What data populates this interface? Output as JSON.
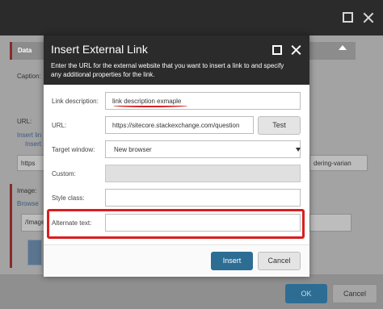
{
  "outer": {
    "section_label": "Data",
    "caption_label": "Caption:",
    "url_label": "URL:",
    "insert_link": "Insert lin",
    "insert_link2": "Insert",
    "url_field_value": "https",
    "url_field_right": "dering-varian",
    "image_label": "Image:",
    "browse_link": "Browse",
    "image_field_value": "/Image",
    "ok_label": "OK",
    "cancel_label": "Cancel"
  },
  "dialog": {
    "title": "Insert External Link",
    "description": "Enter the URL for the external website that you want to insert a link to and specify any additional properties for the link.",
    "link_description_label": "Link description:",
    "link_description_value": "link description exmaple",
    "url_label": "URL:",
    "url_value": "https://sitecore.stackexchange.com/question",
    "test_label": "Test",
    "target_window_label": "Target window:",
    "target_window_value": "New browser",
    "custom_label": "Custom:",
    "style_class_label": "Style class:",
    "alternate_text_label": "Alternate text:",
    "insert_label": "Insert",
    "cancel_label": "Cancel"
  },
  "colors": {
    "titlebar": "#2b2b2b",
    "primary_button": "#2d6d94",
    "highlight": "#d91e1e"
  },
  "icons": [
    "maximize-icon",
    "close-icon",
    "collapse-caret-icon",
    "select-chevron-down-icon"
  ]
}
